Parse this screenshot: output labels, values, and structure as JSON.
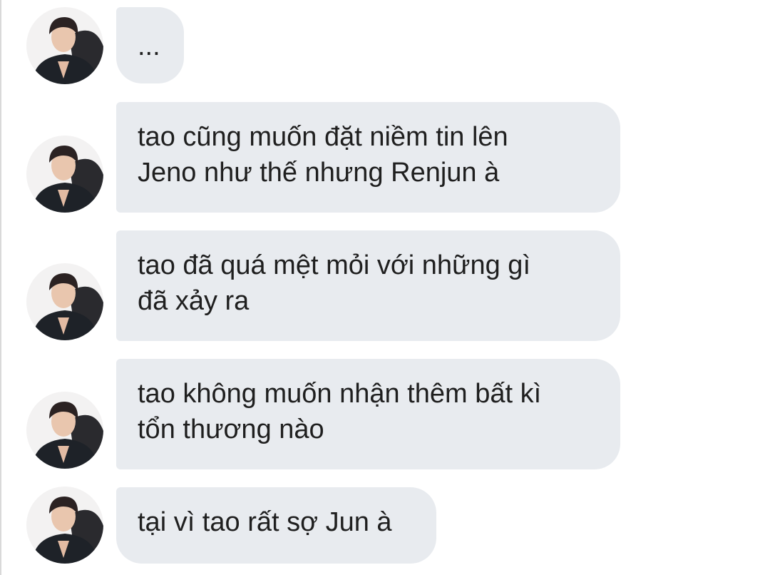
{
  "conversation": {
    "messages": [
      {
        "text": "..."
      },
      {
        "text": "tao cũng muốn đặt niềm tin lên\nJeno như thế nhưng Renjun à"
      },
      {
        "text": "tao đã quá mệt mỏi với những gì\nđã xảy ra"
      },
      {
        "text": "tao không muốn nhận thêm bất kì\ntổn thương nào"
      },
      {
        "text": "tại vì tao rất sợ Jun à"
      }
    ],
    "avatar_icon": "profile-photo-icon"
  },
  "colors": {
    "bubble_bg": "#e8ebef",
    "text": "#1f1f1f",
    "background": "#ffffff"
  }
}
